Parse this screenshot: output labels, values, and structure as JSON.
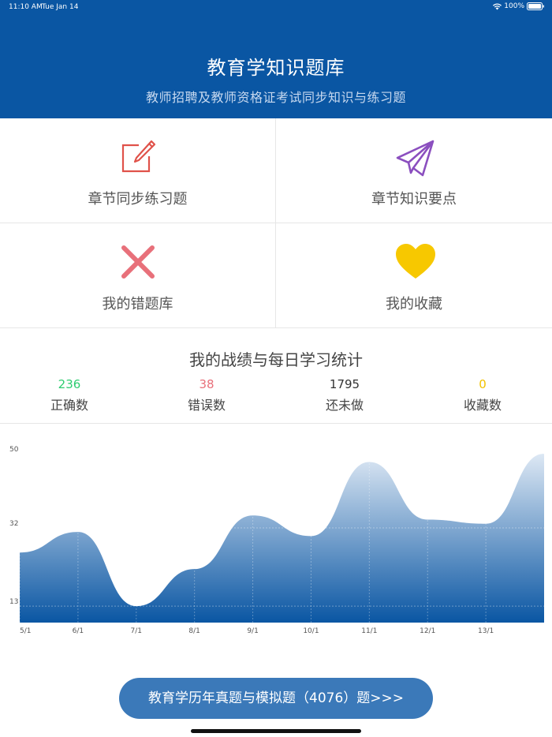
{
  "status_bar": {
    "time": "11:10 AM",
    "date": "Tue Jan 14",
    "battery": "100%"
  },
  "header": {
    "title": "教育学知识题库",
    "subtitle": "教师招聘及教师资格证考试同步知识与练习题"
  },
  "menu": {
    "chapter_practice": "章节同步练习题",
    "chapter_points": "章节知识要点",
    "wrong_questions": "我的错题库",
    "favorites": "我的收藏"
  },
  "stats": {
    "title": "我的战绩与每日学习统计",
    "correct": {
      "value": "236",
      "label": "正确数",
      "color": "#2ecc71"
    },
    "wrong": {
      "value": "38",
      "label": "错误数",
      "color": "#e8707a"
    },
    "undone": {
      "value": "1795",
      "label": "还未做",
      "color": "#333333"
    },
    "favorited": {
      "value": "0",
      "label": "收藏数",
      "color": "#f2c200"
    }
  },
  "chart_data": {
    "type": "area",
    "categories": [
      "5/1",
      "6/1",
      "7/1",
      "8/1",
      "9/1",
      "10/1",
      "11/1",
      "12/1",
      "13/1"
    ],
    "x": [
      "5/1",
      "6/1",
      "7/1",
      "8/1",
      "9/1",
      "10/1",
      "11/1",
      "12/1",
      "13/1",
      ""
    ],
    "values": [
      26,
      31,
      13,
      22,
      35,
      30,
      48,
      34,
      33,
      50
    ],
    "y_ticks": [
      "50",
      "32",
      "13"
    ],
    "ylim": [
      9,
      50
    ],
    "grid": true,
    "color_top": "#dde8f4",
    "color_bottom": "#0a56a3"
  },
  "bottom_button": {
    "label": "教育学历年真题与模拟题（4076）题>>>"
  }
}
